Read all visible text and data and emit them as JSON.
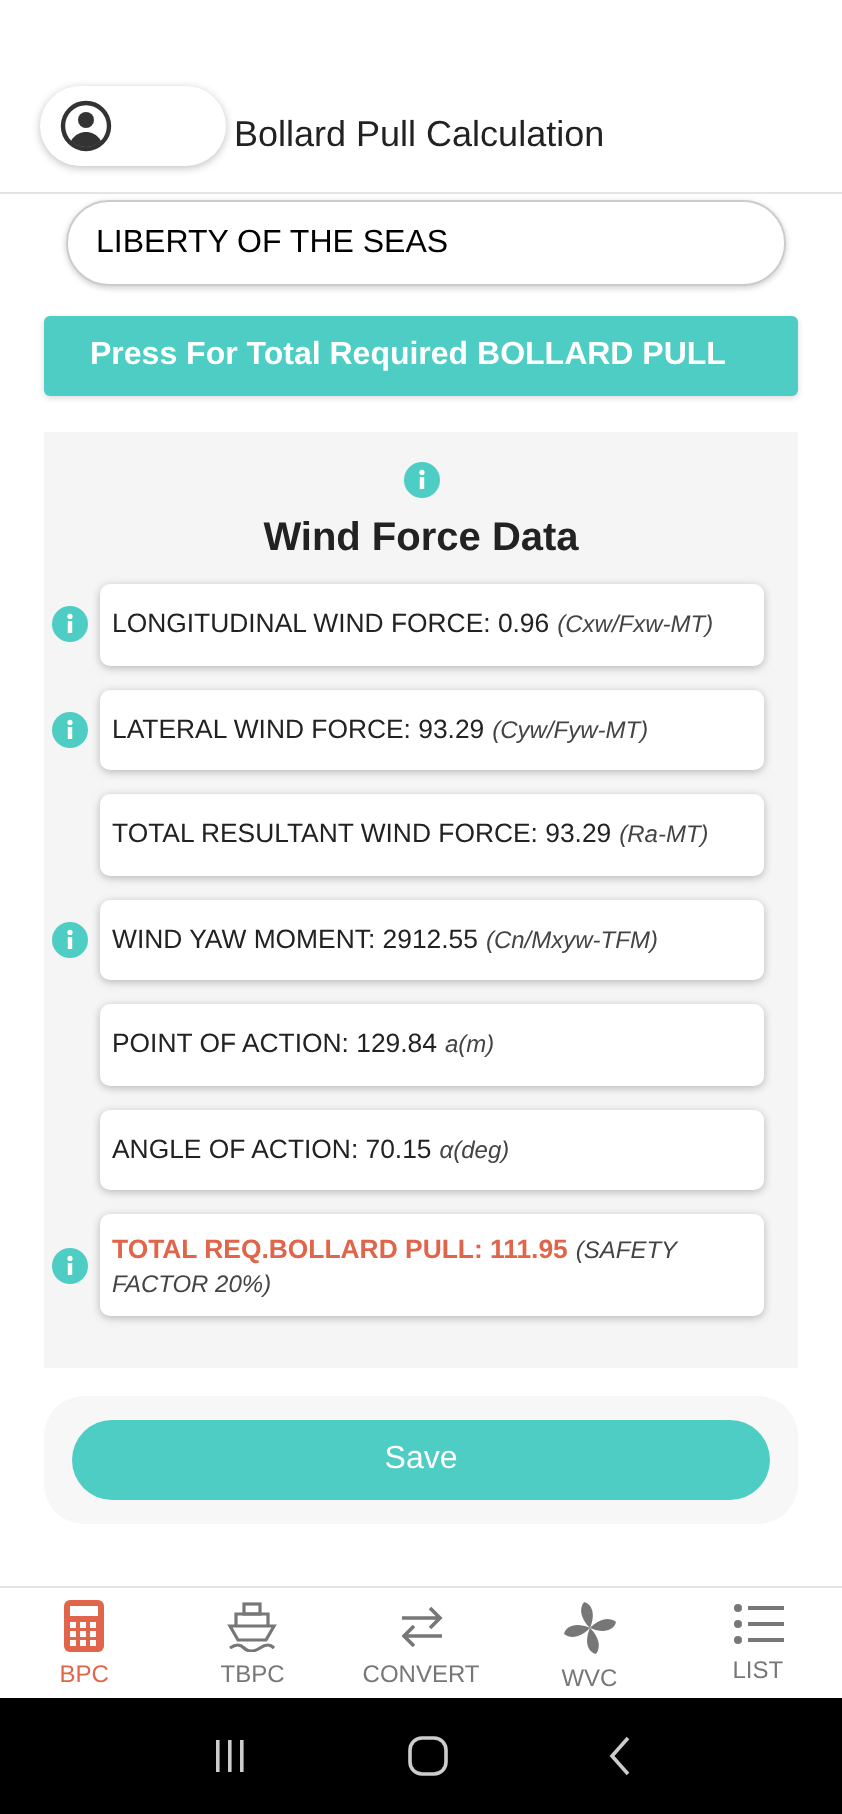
{
  "header": {
    "title": "Bollard Pull Calculation"
  },
  "ship_field": {
    "value": "LIBERTY OF THE SEAS"
  },
  "action_button": {
    "label": "Press For Total Required BOLLARD PULL"
  },
  "panel": {
    "title": "Wind Force Data",
    "info": true,
    "rows": [
      {
        "kind": "normal",
        "info": true,
        "text": "LONGITUDINAL WIND FORCE: 0.96",
        "unit": "(Cxw/Fxw-MT)"
      },
      {
        "kind": "normal",
        "info": true,
        "text": "LATERAL WIND FORCE: 93.29",
        "unit": "(Cyw/Fyw-MT)"
      },
      {
        "kind": "normal",
        "info": false,
        "text": "TOTAL RESULTANT WIND FORCE: 93.29",
        "unit": "(Ra-MT)"
      },
      {
        "kind": "normal",
        "info": true,
        "text": "WIND YAW MOMENT: 2912.55",
        "unit": "(Cn/Mxyw-TFM)"
      },
      {
        "kind": "normal",
        "info": false,
        "text": "POINT OF ACTION: 129.84",
        "unit": "a(m)"
      },
      {
        "kind": "normal",
        "info": false,
        "text": "ANGLE OF ACTION: 70.15",
        "unit": "α(deg)"
      },
      {
        "kind": "total",
        "info": true,
        "text": "TOTAL REQ.BOLLARD PULL: 111.95",
        "unit": "(SAFETY FACTOR 20%)"
      }
    ]
  },
  "save_button": {
    "label": "Save"
  },
  "bottom_nav": [
    {
      "label": "BPC",
      "selected": true
    },
    {
      "label": "TBPC",
      "selected": false
    },
    {
      "label": "CONVERT",
      "selected": false
    },
    {
      "label": "WVC",
      "selected": false
    },
    {
      "label": "LIST",
      "selected": false
    }
  ]
}
